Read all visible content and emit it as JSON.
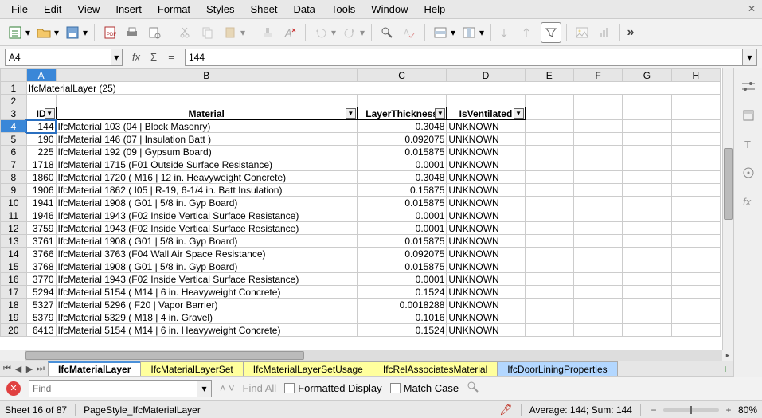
{
  "menu": {
    "file": "File",
    "edit": "Edit",
    "view": "View",
    "insert": "Insert",
    "format": "Format",
    "styles": "Styles",
    "sheet": "Sheet",
    "data": "Data",
    "tools": "Tools",
    "window": "Window",
    "help": "Help"
  },
  "cell_ref": "A4",
  "formula_value": "144",
  "columns": [
    "A",
    "B",
    "C",
    "D",
    "E",
    "F",
    "G",
    "H"
  ],
  "title_row": "IfcMaterialLayer  (25)",
  "headers": {
    "id": "ID",
    "material": "Material",
    "thickness": "LayerThickness",
    "vent": "IsVentilated"
  },
  "rows": [
    {
      "n": 4,
      "id": "144",
      "mat": "IfcMaterial 103  (04 | Block Masonry)",
      "th": "0.3048",
      "v": "UNKNOWN"
    },
    {
      "n": 5,
      "id": "190",
      "mat": "IfcMaterial 146  (07 | Insulation Batt )",
      "th": "0.092075",
      "v": "UNKNOWN"
    },
    {
      "n": 6,
      "id": "225",
      "mat": "IfcMaterial 192  (09 | Gypsum Board)",
      "th": "0.015875",
      "v": "UNKNOWN"
    },
    {
      "n": 7,
      "id": "1718",
      "mat": "IfcMaterial 1715  (F01 Outside Surface Resistance)",
      "th": "0.0001",
      "v": "UNKNOWN"
    },
    {
      "n": 8,
      "id": "1860",
      "mat": "IfcMaterial 1720  ( M16 | 12 in. Heavyweight Concrete)",
      "th": "0.3048",
      "v": "UNKNOWN"
    },
    {
      "n": 9,
      "id": "1906",
      "mat": "IfcMaterial 1862  ( I05 | R-19, 6-1/4 in. Batt Insulation)",
      "th": "0.15875",
      "v": "UNKNOWN"
    },
    {
      "n": 10,
      "id": "1941",
      "mat": "IfcMaterial 1908  ( G01 | 5/8 in. Gyp Board)",
      "th": "0.015875",
      "v": "UNKNOWN"
    },
    {
      "n": 11,
      "id": "1946",
      "mat": "IfcMaterial 1943  (F02 Inside Vertical Surface Resistance)",
      "th": "0.0001",
      "v": "UNKNOWN"
    },
    {
      "n": 12,
      "id": "3759",
      "mat": "IfcMaterial 1943  (F02 Inside Vertical Surface Resistance)",
      "th": "0.0001",
      "v": "UNKNOWN"
    },
    {
      "n": 13,
      "id": "3761",
      "mat": "IfcMaterial 1908  ( G01 | 5/8 in. Gyp Board)",
      "th": "0.015875",
      "v": "UNKNOWN"
    },
    {
      "n": 14,
      "id": "3766",
      "mat": "IfcMaterial 3763  (F04 Wall Air Space Resistance)",
      "th": "0.092075",
      "v": "UNKNOWN"
    },
    {
      "n": 15,
      "id": "3768",
      "mat": "IfcMaterial 1908  ( G01 | 5/8 in. Gyp Board)",
      "th": "0.015875",
      "v": "UNKNOWN"
    },
    {
      "n": 16,
      "id": "3770",
      "mat": "IfcMaterial 1943  (F02 Inside Vertical Surface Resistance)",
      "th": "0.0001",
      "v": "UNKNOWN"
    },
    {
      "n": 17,
      "id": "5294",
      "mat": "IfcMaterial 5154  ( M14 | 6 in. Heavyweight Concrete)",
      "th": "0.1524",
      "v": "UNKNOWN"
    },
    {
      "n": 18,
      "id": "5327",
      "mat": "IfcMaterial 5296  ( F20 | Vapor Barrier)",
      "th": "0.0018288",
      "v": "UNKNOWN"
    },
    {
      "n": 19,
      "id": "5379",
      "mat": "IfcMaterial 5329  ( M18 | 4 in. Gravel)",
      "th": "0.1016",
      "v": "UNKNOWN"
    },
    {
      "n": 20,
      "id": "6413",
      "mat": "IfcMaterial 5154  ( M14 | 6 in. Heavyweight Concrete)",
      "th": "0.1524",
      "v": "UNKNOWN"
    }
  ],
  "tabs": [
    {
      "label": "IfcMaterialLayer",
      "cls": "active"
    },
    {
      "label": "IfcMaterialLayerSet",
      "cls": "y"
    },
    {
      "label": "IfcMaterialLayerSetUsage",
      "cls": "y"
    },
    {
      "label": "IfcRelAssociatesMaterial",
      "cls": "y"
    },
    {
      "label": "IfcDoorLiningProperties",
      "cls": "b"
    }
  ],
  "find": {
    "placeholder": "Find",
    "findall": "Find All",
    "formatted": "Formatted Display",
    "matchcase": "Match Case"
  },
  "status": {
    "sheet": "Sheet 16 of 87",
    "pagestyle": "PageStyle_IfcMaterialLayer",
    "summary": "Average: 144; Sum: 144",
    "zoom": "80%"
  }
}
